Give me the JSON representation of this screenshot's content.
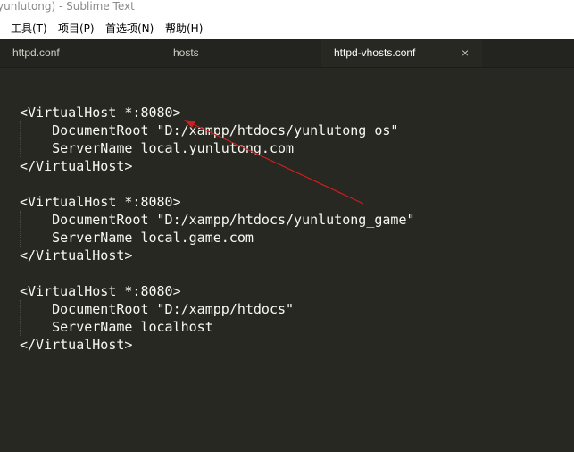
{
  "window": {
    "title": "yunlutong) - Sublime Text"
  },
  "menu": {
    "items": [
      "工具(T)",
      "项目(P)",
      "首选项(N)",
      "帮助(H)"
    ]
  },
  "tabs": [
    {
      "label": "httpd.conf",
      "active": false
    },
    {
      "label": "hosts",
      "active": false
    },
    {
      "label": "httpd-vhosts.conf",
      "active": true
    }
  ],
  "tab_close_glyph": "×",
  "editor": {
    "lines": [
      "<VirtualHost *:8080>",
      "    DocumentRoot \"D:/xampp/htdocs/yunlutong_os\"",
      "    ServerName local.yunlutong.com",
      "</VirtualHost>",
      "",
      "<VirtualHost *:8080>",
      "    DocumentRoot \"D:/xampp/htdocs/yunlutong_game\"",
      "    ServerName local.game.com",
      "</VirtualHost>",
      "",
      "<VirtualHost *:8080>",
      "    DocumentRoot \"D:/xampp/htdocs\"",
      "    ServerName localhost",
      "</VirtualHost>"
    ]
  },
  "annotation": {
    "color": "#cc1f1f"
  },
  "colors": {
    "editor_bg": "#272822",
    "tabbar_bg": "#23241f",
    "text": "#f8f8f2"
  }
}
